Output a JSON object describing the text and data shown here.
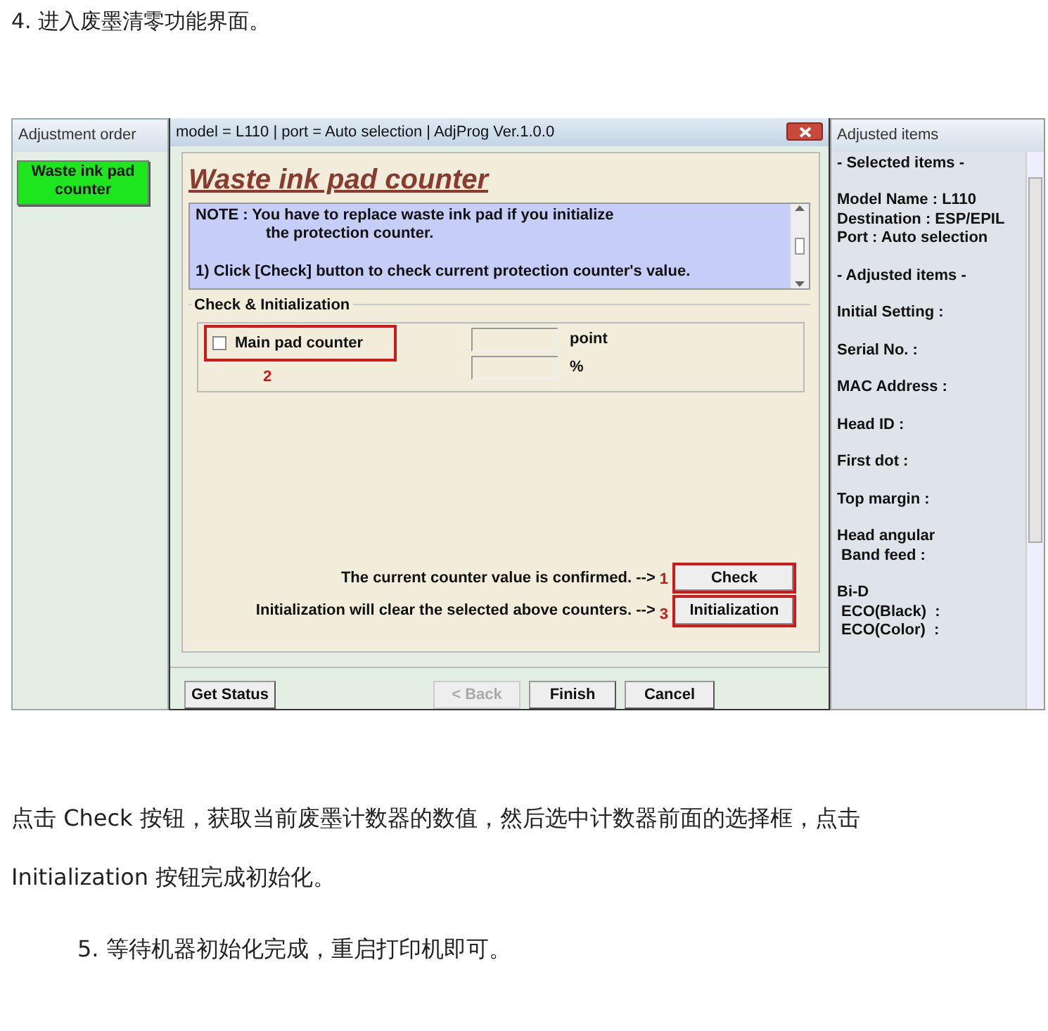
{
  "heading": "4. 进入废墨清零功能界面。",
  "app": {
    "left_panel": {
      "title": "Adjustment order",
      "items": [
        {
          "label": "Waste ink pad\ncounter",
          "selected": true
        }
      ]
    },
    "dialog": {
      "title": "model = L110 | port = Auto selection | AdjProg Ver.1.0.0",
      "heading": "Waste ink pad counter",
      "note": [
        "NOTE : You have to replace waste ink pad if you initialize",
        "the protection counter.",
        "1) Click [Check] button to check current protection counter's value."
      ],
      "group": {
        "title": "Check & Initialization",
        "counters": [
          {
            "label": "Main pad counter",
            "checked": false,
            "highlighted": true,
            "marker": "2",
            "units": [
              "point",
              "%"
            ]
          }
        ]
      },
      "actions": [
        {
          "text": "The current counter value is confirmed. -->",
          "marker": "1",
          "button": "Check",
          "highlighted": true
        },
        {
          "text": "Initialization will clear the selected above counters. -->",
          "marker": "3",
          "button": "Initialization",
          "highlighted": true
        }
      ],
      "footer_buttons": [
        {
          "label": "Get Status",
          "disabled": false
        },
        {
          "label": "< Back",
          "disabled": true
        },
        {
          "label": "Finish",
          "disabled": false
        },
        {
          "label": "Cancel",
          "disabled": false
        }
      ]
    },
    "right_panel": {
      "title": "Adjusted items",
      "entries": [
        "- Selected items -",
        "Model Name : L110\nDestination : ESP/EPIL\nPort : Auto selection",
        "- Adjusted items -",
        "Initial Setting :",
        "Serial No. :",
        "MAC Address :",
        "Head ID :",
        "First dot :",
        "Top margin :",
        "Head angular\n Band feed :",
        "Bi-D\n ECO(Black)  :\n ECO(Color)  :"
      ]
    }
  },
  "paragraph": "点击 Check 按钮，获取当前废墨计数器的数值，然后选中计数器前面的选择框，点击 Initialization 按钮完成初始化。",
  "step": "5. 等待机器初始化完成，重启打印机即可。"
}
